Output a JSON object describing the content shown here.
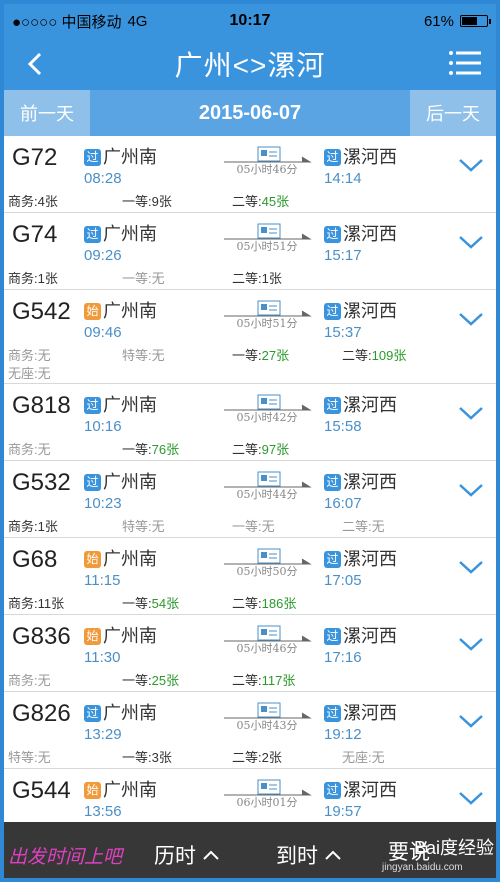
{
  "status": {
    "carrier": "●○○○○ 中国移动",
    "network": "4G",
    "time": "10:17",
    "battery": "61%",
    "battery_level": 0.61
  },
  "header": {
    "title": "广州<>漯河"
  },
  "datebar": {
    "prev": "前一天",
    "date": "2015-06-07",
    "next": "后一天"
  },
  "trains": [
    {
      "code": "G72",
      "from_tag": "过",
      "from": "广州南",
      "dep": "08:28",
      "duration": "05小时46分",
      "to_tag": "过",
      "to": "漯河西",
      "arr": "14:14",
      "seats": [
        {
          "label": "商务:",
          "num": "4张",
          "avail": true
        },
        {
          "label": "一等:",
          "num": "9张",
          "avail": true
        },
        {
          "label": "二等:",
          "num": "45张",
          "avail": true,
          "green": true
        }
      ]
    },
    {
      "code": "G74",
      "from_tag": "过",
      "from": "广州南",
      "dep": "09:26",
      "duration": "05小时51分",
      "to_tag": "过",
      "to": "漯河西",
      "arr": "15:17",
      "seats": [
        {
          "label": "商务:",
          "num": "1张",
          "avail": true
        },
        {
          "label": "一等:",
          "num": "无",
          "avail": false
        },
        {
          "label": "二等:",
          "num": "1张",
          "avail": true
        }
      ]
    },
    {
      "code": "G542",
      "from_tag": "始",
      "from": "广州南",
      "dep": "09:46",
      "duration": "05小时51分",
      "to_tag": "过",
      "to": "漯河西",
      "arr": "15:37",
      "seats": [
        {
          "label": "商务:",
          "num": "无",
          "avail": false
        },
        {
          "label": "特等:",
          "num": "无",
          "avail": false
        },
        {
          "label": "一等:",
          "num": "27张",
          "avail": true,
          "green": true
        },
        {
          "label": "二等:",
          "num": "109张",
          "avail": true,
          "green": true
        },
        {
          "label": "无座:",
          "num": "无",
          "avail": false
        }
      ]
    },
    {
      "code": "G818",
      "from_tag": "过",
      "from": "广州南",
      "dep": "10:16",
      "duration": "05小时42分",
      "to_tag": "过",
      "to": "漯河西",
      "arr": "15:58",
      "seats": [
        {
          "label": "商务:",
          "num": "无",
          "avail": false
        },
        {
          "label": "一等:",
          "num": "76张",
          "avail": true,
          "green": true
        },
        {
          "label": "二等:",
          "num": "97张",
          "avail": true,
          "green": true
        }
      ]
    },
    {
      "code": "G532",
      "from_tag": "过",
      "from": "广州南",
      "dep": "10:23",
      "duration": "05小时44分",
      "to_tag": "过",
      "to": "漯河西",
      "arr": "16:07",
      "seats": [
        {
          "label": "商务:",
          "num": "1张",
          "avail": true
        },
        {
          "label": "特等:",
          "num": "无",
          "avail": false
        },
        {
          "label": "一等:",
          "num": "无",
          "avail": false
        },
        {
          "label": "二等:",
          "num": "无",
          "avail": false
        }
      ]
    },
    {
      "code": "G68",
      "from_tag": "始",
      "from": "广州南",
      "dep": "11:15",
      "duration": "05小时50分",
      "to_tag": "过",
      "to": "漯河西",
      "arr": "17:05",
      "seats": [
        {
          "label": "商务:",
          "num": "11张",
          "avail": true
        },
        {
          "label": "一等:",
          "num": "54张",
          "avail": true,
          "green": true
        },
        {
          "label": "二等:",
          "num": "186张",
          "avail": true,
          "green": true
        }
      ]
    },
    {
      "code": "G836",
      "from_tag": "始",
      "from": "广州南",
      "dep": "11:30",
      "duration": "05小时46分",
      "to_tag": "过",
      "to": "漯河西",
      "arr": "17:16",
      "seats": [
        {
          "label": "商务:",
          "num": "无",
          "avail": false
        },
        {
          "label": "一等:",
          "num": "25张",
          "avail": true,
          "green": true
        },
        {
          "label": "二等:",
          "num": "117张",
          "avail": true,
          "green": true
        }
      ]
    },
    {
      "code": "G826",
      "from_tag": "过",
      "from": "广州南",
      "dep": "13:29",
      "duration": "05小时43分",
      "to_tag": "过",
      "to": "漯河西",
      "arr": "19:12",
      "seats": [
        {
          "label": "特等:",
          "num": "无",
          "avail": false
        },
        {
          "label": "一等:",
          "num": "3张",
          "avail": true
        },
        {
          "label": "二等:",
          "num": "2张",
          "avail": true
        },
        {
          "label": "无座:",
          "num": "无",
          "avail": false
        }
      ]
    },
    {
      "code": "G544",
      "from_tag": "始",
      "from": "广州南",
      "dep": "13:56",
      "duration": "06小时01分",
      "to_tag": "过",
      "to": "漯河西",
      "arr": "19:57",
      "seats": []
    }
  ],
  "bottom": {
    "duration_sort": "历时",
    "arrive_sort": "到时",
    "watermark": "Bai度经验",
    "site": "jingyan.baidu.com",
    "overlay": "出发时间上吧",
    "filter": "要说"
  },
  "colors": {
    "primary": "#3a93dd",
    "available": "#2a9a2a",
    "time": "#4a90c8"
  }
}
